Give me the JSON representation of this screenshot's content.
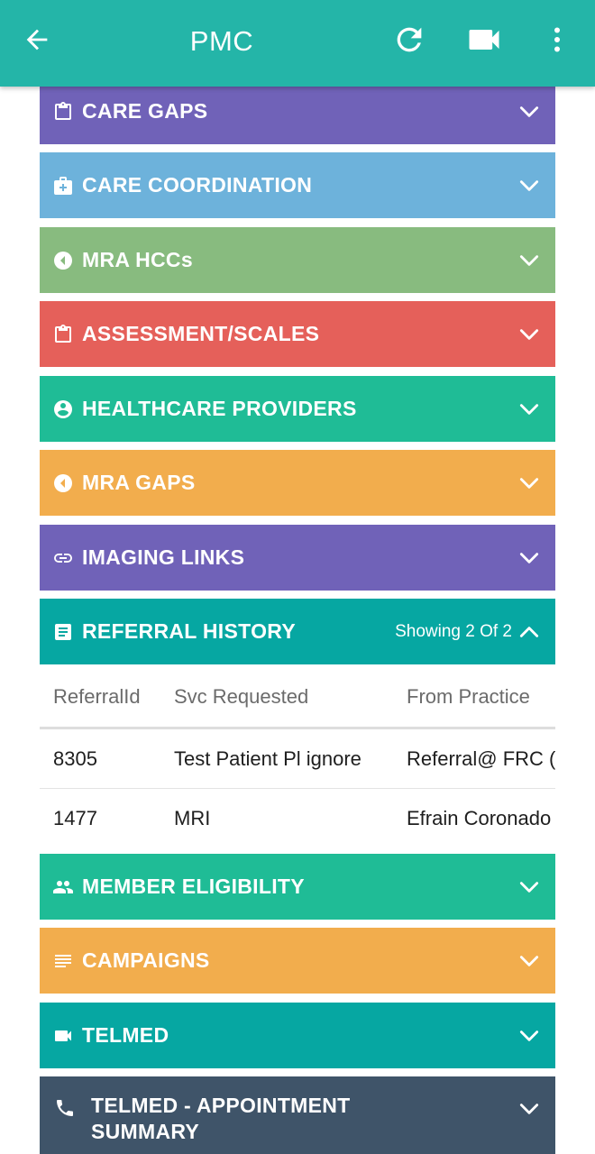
{
  "app_bar": {
    "title": "PMC",
    "back_icon": "arrow-back-icon",
    "refresh_icon": "refresh-icon",
    "video_icon": "video-camera-icon",
    "more_icon": "more-vert-icon",
    "color": "#24b5a8"
  },
  "sections": [
    {
      "label": "CARE GAPS",
      "icon": "clipboard-icon",
      "color": "#7062b8",
      "state": "collapsed"
    },
    {
      "label": "CARE COORDINATION",
      "icon": "medical-kit-icon",
      "color": "#6db2db",
      "state": "collapsed"
    },
    {
      "label": "MRA HCCs",
      "icon": "back-circle-icon",
      "color": "#88bb7f",
      "state": "collapsed"
    },
    {
      "label": "ASSESSMENT/SCALES",
      "icon": "clipboard-icon",
      "color": "#e5605a",
      "state": "collapsed"
    },
    {
      "label": "HEALTHCARE PROVIDERS",
      "icon": "account-circle-icon",
      "color": "#1fbc96",
      "state": "collapsed"
    },
    {
      "label": "MRA GAPS",
      "icon": "back-circle-icon",
      "color": "#f2ad4d",
      "state": "collapsed"
    },
    {
      "label": "IMAGING LINKS",
      "icon": "link-icon",
      "color": "#7062b8",
      "state": "collapsed"
    },
    {
      "label": "REFERRAL HISTORY",
      "icon": "document-icon",
      "color": "#06a7a2",
      "state": "expanded",
      "showing": "Showing 2 Of 2"
    },
    {
      "label": "MEMBER ELIGIBILITY",
      "icon": "people-icon",
      "color": "#1fbc96",
      "state": "collapsed"
    },
    {
      "label": "CAMPAIGNS",
      "icon": "list-lines-icon",
      "color": "#f2ad4d",
      "state": "collapsed"
    },
    {
      "label": "TELMED",
      "icon": "video-camera-icon",
      "color": "#06a7a2",
      "state": "collapsed"
    },
    {
      "label": "TELMED - APPOINTMENT SUMMARY",
      "label_line1": "TELMED - APPOINTMENT",
      "label_line2": "SUMMARY",
      "icon": "phone-icon",
      "color": "#3f5469",
      "state": "collapsed"
    }
  ],
  "referral_table": {
    "columns": [
      "ReferralId",
      "Svc Requested",
      "From Practice"
    ],
    "rows": [
      [
        "8305",
        "Test Patient Pl ignore",
        "Referral@ FRC ("
      ],
      [
        "1477",
        "MRI",
        "Efrain Coronado"
      ]
    ]
  }
}
